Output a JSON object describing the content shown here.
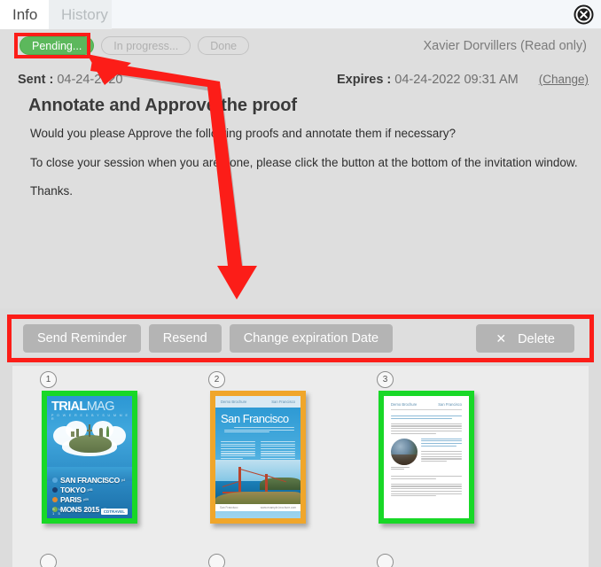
{
  "window": {
    "tabs": [
      {
        "label": "Info",
        "active": true
      },
      {
        "label": "History",
        "active": false
      }
    ],
    "close_label": "×",
    "close_icon": "close-circle-icon"
  },
  "status": {
    "pending_label": "Pending...",
    "in_progress_label": "In progress...",
    "done_label": "Done",
    "active": "Pending...",
    "active_color": "#5cb85c",
    "highlight_color": "#fc1d18"
  },
  "recipient": {
    "name_and_role": "Xavier Dorvillers (Read only)"
  },
  "meta": {
    "sent_label": "Sent :",
    "sent_value": "04-24-2020",
    "expires_label": "Expires :",
    "expires_value": "04-24-2022 09:31 AM",
    "change_link": "(Change)"
  },
  "message": {
    "title": "Annotate and Approve the proof",
    "paragraphs": [
      "Would you please Approve the following proofs and annotate them if necessary?",
      "To close your session when you are done, please click the button at the bottom of the invitation window.",
      "Thanks."
    ]
  },
  "toolbar": {
    "send_reminder_label": "Send Reminder",
    "resend_label": "Resend",
    "change_expiration_label": "Change expiration Date",
    "delete_label": "Delete",
    "delete_icon_label": "✕",
    "delete_icon": "x-icon",
    "button_color": "#b4b4b4",
    "highlight_color": "#fc1d18"
  },
  "annotation": {
    "arrow_color": "#fc1d18",
    "arrow_description": "red bent double-headed arrow from Pending pill down to action toolbar"
  },
  "thumbnails": {
    "pages": [
      {
        "number": "1",
        "border_color": "#18d827",
        "kind": "magazine-cover",
        "title_bold": "TRIAL",
        "title_light": "MAG",
        "subtitle": "P O W E R E D   B Y   S U M M E R",
        "destinations": [
          {
            "name": "SAN FRANCISCO",
            "page": "p.4",
            "dot_color": "#5aa9dd"
          },
          {
            "name": "TOKYO",
            "page": "p.06",
            "dot_color": "#1b3e6e"
          },
          {
            "name": "PARIS",
            "page": "p.09",
            "dot_color": "#e08a32"
          },
          {
            "name": "MONS 2015",
            "page": "p.12",
            "dot_color": "#7fae4a"
          }
        ],
        "footer_text": "S U M M E R   2 0 1 5",
        "badge": "CDTRAVEL"
      },
      {
        "number": "2",
        "border_color": "#f0a62b",
        "kind": "brochure-cover",
        "header_left": "Demo Brochure",
        "header_right": "San Francisco",
        "headline": "San Francisco",
        "footer_left": "San Francisco",
        "footer_right": "www.example-brochure.com"
      },
      {
        "number": "3",
        "border_color": "#18d827",
        "kind": "text-page",
        "header_left": "Demo Brochure",
        "header_right": "San Francisco"
      }
    ],
    "second_row_visible_count": 3
  }
}
